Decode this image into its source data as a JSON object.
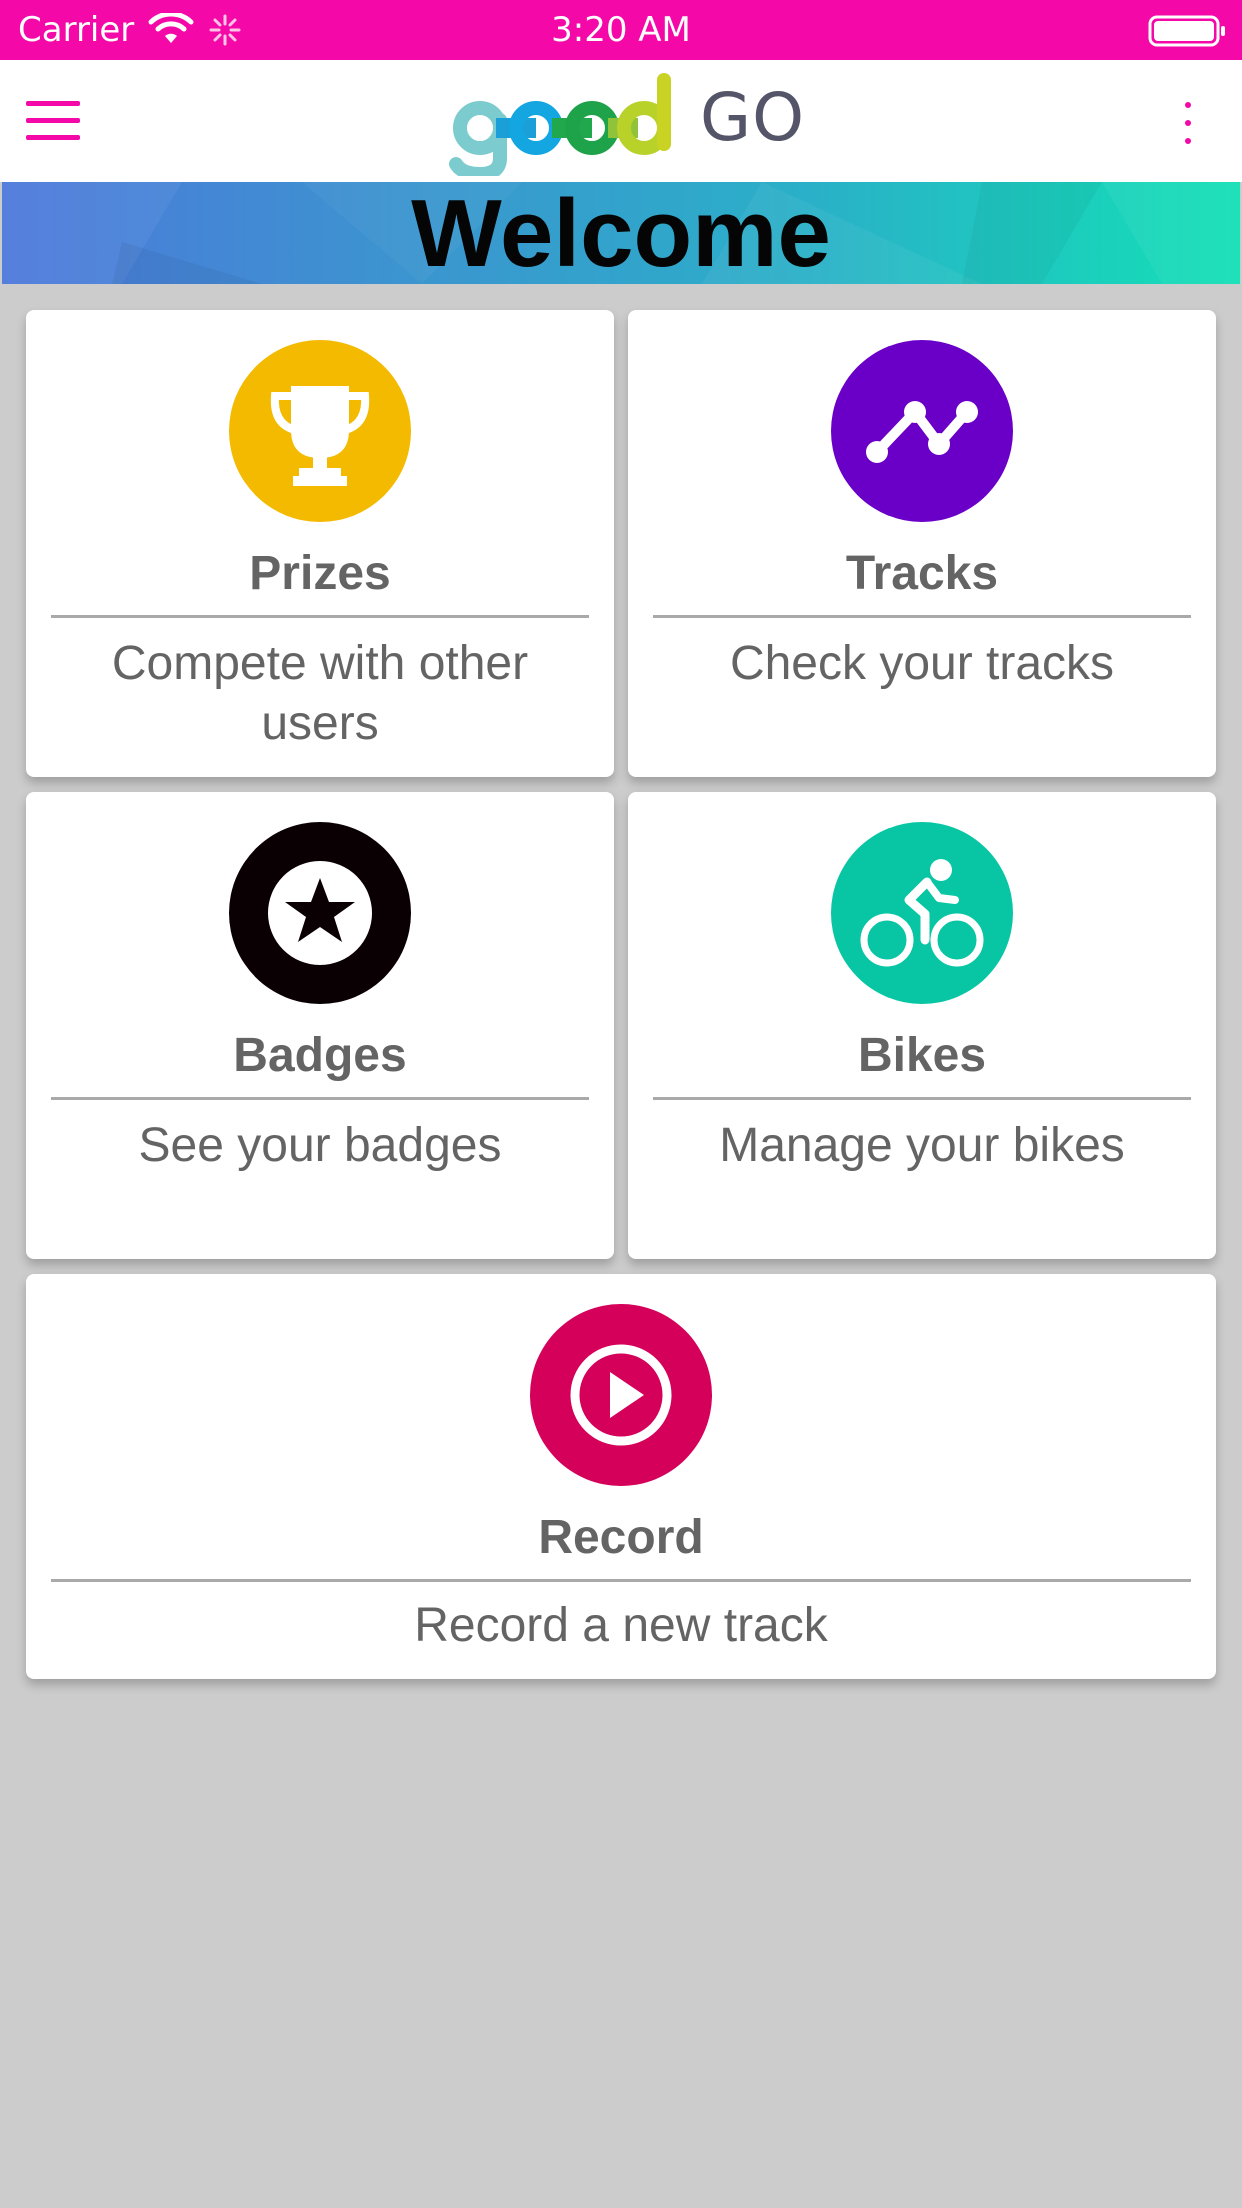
{
  "status_bar": {
    "carrier": "Carrier",
    "time": "3:20 AM",
    "background": "#f408a8",
    "icons": [
      "wifi-icon",
      "activity-spinner-icon",
      "battery-icon"
    ]
  },
  "app_bar": {
    "logo_word": "good",
    "logo_suffix": "GO",
    "menu_icon": "hamburger-menu-icon",
    "overflow_icon": "more-vertical-icon",
    "accent": "#f408a8"
  },
  "banner": {
    "title": "Welcome"
  },
  "cards": [
    {
      "title": "Prizes",
      "description": "Compete with other users",
      "icon": "trophy-icon",
      "color": "#f4ba00"
    },
    {
      "title": "Tracks",
      "description": "Check your tracks",
      "icon": "track-line-icon",
      "color": "#6a00c8"
    },
    {
      "title": "Badges",
      "description": "See your badges",
      "icon": "star-badge-icon",
      "color": "#0a0003"
    },
    {
      "title": "Bikes",
      "description": "Manage your bikes",
      "icon": "cyclist-icon",
      "color": "#08c6a4"
    },
    {
      "title": "Record",
      "description": "Record a new track",
      "icon": "play-circle-icon",
      "color": "#d4005a"
    }
  ]
}
